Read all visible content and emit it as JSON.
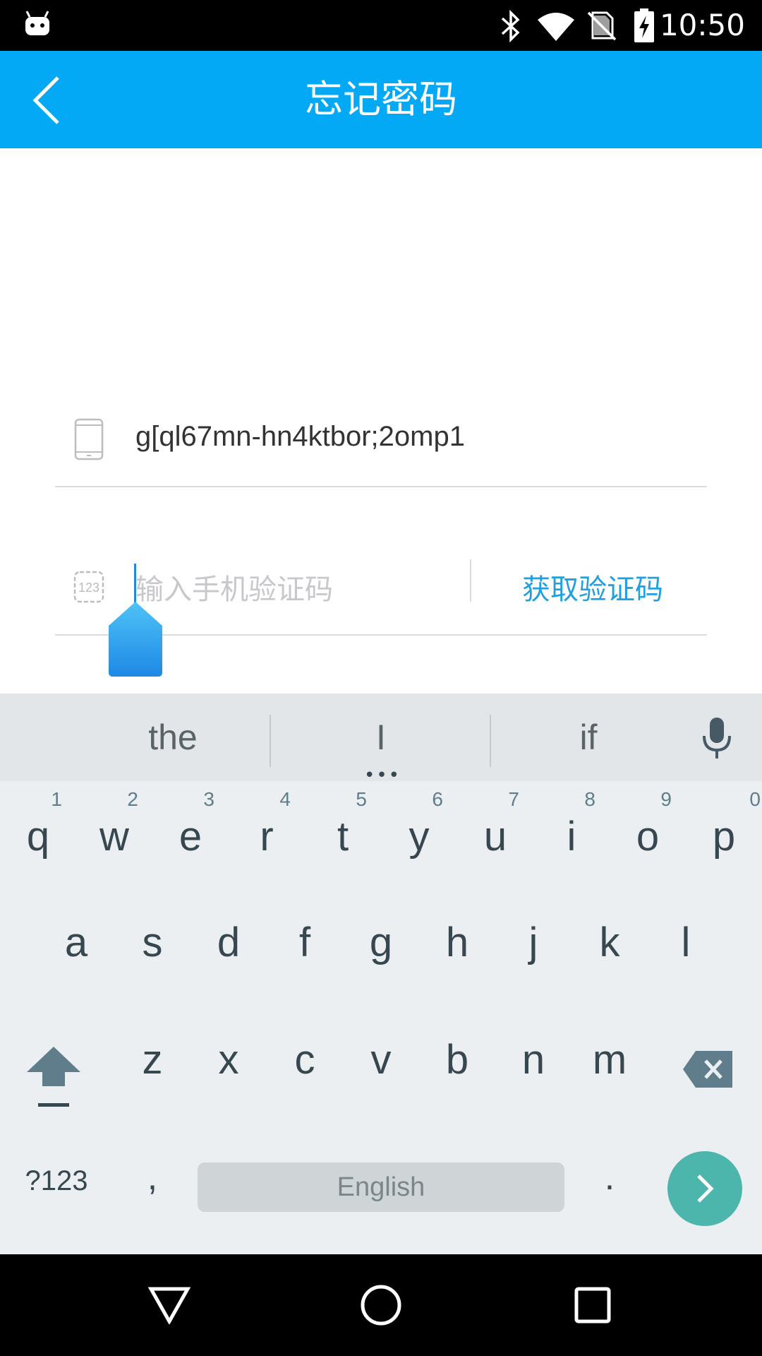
{
  "status_bar": {
    "time": "10:50",
    "icons": [
      "android-icon",
      "bluetooth-icon",
      "wifi-icon",
      "no-sim-icon",
      "battery-charging-icon"
    ]
  },
  "app_bar": {
    "title": "忘记密码",
    "back_icon": "chevron-left-icon"
  },
  "form": {
    "phone": {
      "icon": "phone-icon",
      "value": "g[ql67mn-hn4ktbor;2omp1"
    },
    "code": {
      "icon": "code-123-icon",
      "placeholder": "输入手机验证码",
      "value": "",
      "get_code_label": "获取验证码"
    }
  },
  "keyboard": {
    "suggestions": [
      "the",
      "I",
      "if"
    ],
    "row1": [
      {
        "key": "q",
        "hint": "1"
      },
      {
        "key": "w",
        "hint": "2"
      },
      {
        "key": "e",
        "hint": "3"
      },
      {
        "key": "r",
        "hint": "4"
      },
      {
        "key": "t",
        "hint": "5"
      },
      {
        "key": "y",
        "hint": "6"
      },
      {
        "key": "u",
        "hint": "7"
      },
      {
        "key": "i",
        "hint": "8"
      },
      {
        "key": "o",
        "hint": "9"
      },
      {
        "key": "p",
        "hint": "0"
      }
    ],
    "row2": [
      "a",
      "s",
      "d",
      "f",
      "g",
      "h",
      "j",
      "k",
      "l"
    ],
    "row3": [
      "z",
      "x",
      "c",
      "v",
      "b",
      "n",
      "m"
    ],
    "symbols_label": "?123",
    "comma": ",",
    "space_label": "English",
    "period": ".",
    "accent_color": "#4db6ac"
  },
  "nav_bar": {
    "icons": [
      "back-triangle-icon",
      "home-circle-icon",
      "recents-square-icon"
    ]
  },
  "colors": {
    "app_bar": "#03a9f4",
    "link": "#1fa0e0"
  }
}
